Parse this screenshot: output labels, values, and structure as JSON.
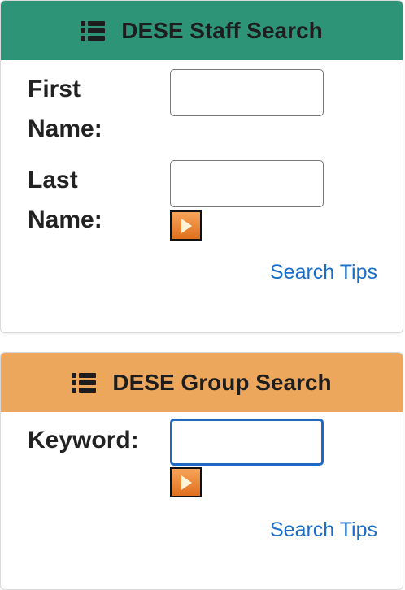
{
  "staff_search": {
    "title": "DESE Staff Search",
    "first_name_label": "First Name:",
    "first_name_value": "",
    "last_name_label": "Last Name:",
    "last_name_value": "",
    "tips_label": "Search Tips",
    "header_color": "#2e9478"
  },
  "group_search": {
    "title": "DESE Group Search",
    "keyword_label": "Keyword:",
    "keyword_value": "",
    "tips_label": "Search Tips",
    "header_color": "#eca75c"
  },
  "icons": {
    "header_icon": "list-icon",
    "submit_icon": "play-arrow-icon"
  },
  "colors": {
    "link": "#1a6ec9",
    "focus_border": "#1f68c4",
    "button_orange": "#e0701d"
  }
}
